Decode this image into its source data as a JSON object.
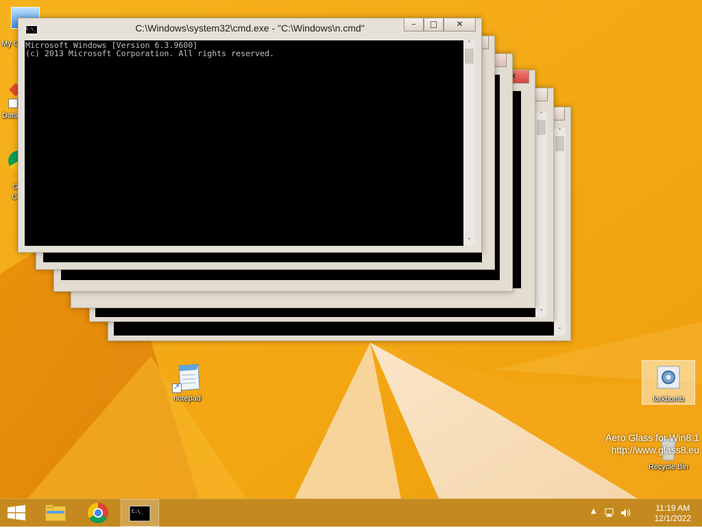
{
  "desktop_icons": [
    {
      "name": "notepad-icon",
      "label": "notepad"
    },
    {
      "name": "forkbomb-icon",
      "label": "forkbomb"
    },
    {
      "name": "recycle-bin-icon",
      "label": "Recycle Bin"
    }
  ],
  "partial_icons": {
    "mycomputer": "My C",
    "data": "Data",
    "chrome_line1": "G",
    "chrome_line2": "C"
  },
  "front_window": {
    "title": "C:\\Windows\\system32\\cmd.exe - \"C:\\Windows\\n.cmd\"",
    "console_lines": [
      "Microsoft Windows [Version 6.3.9600]",
      "(c) 2013 Microsoft Corporation. All rights reserved."
    ],
    "buttons": {
      "minimize": "–",
      "maximize": "□",
      "close": "✕"
    }
  },
  "watermark": {
    "line1": "Aero Glass for Win8.1",
    "line2": "http://www.glass8.eu"
  },
  "taskbar": {
    "items": [
      "start-button",
      "file-explorer",
      "chrome",
      "command-prompt"
    ],
    "tray": {
      "time": "11:19 AM",
      "date": "12/1/2022"
    }
  },
  "colors": {
    "wallpaper": "#f2a512",
    "taskbar": "#c48a1f",
    "window_frame": "#e2dcd1",
    "console_bg": "#000000",
    "console_fg": "#c0c0c0"
  }
}
